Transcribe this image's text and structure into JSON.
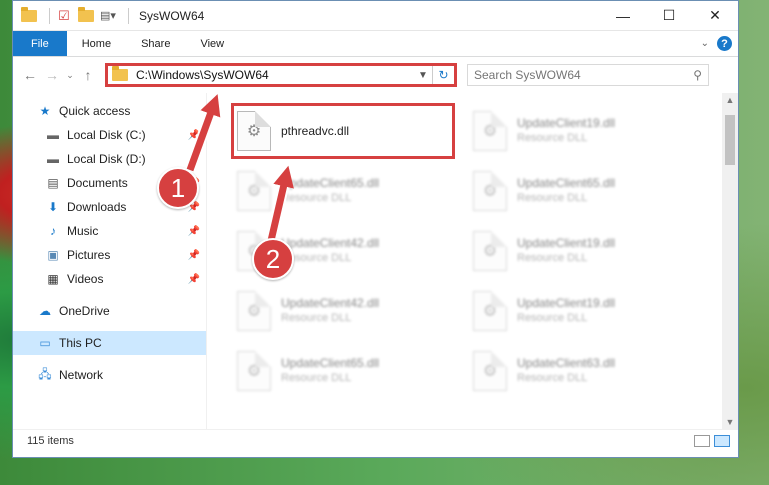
{
  "window": {
    "title": "SysWOW64",
    "controls": {
      "minimize": "—",
      "maximize": "☐",
      "close": "✕"
    }
  },
  "ribbon": {
    "tabs": [
      "File",
      "Home",
      "Share",
      "View"
    ]
  },
  "address": {
    "path": "C:\\Windows\\SysWOW64",
    "search_placeholder": "Search SysWOW64"
  },
  "nav": {
    "quick_access": "Quick access",
    "items": [
      {
        "label": "Local Disk (C:)",
        "icon": "drive-icon"
      },
      {
        "label": "Local Disk (D:)",
        "icon": "drive-icon"
      },
      {
        "label": "Documents",
        "icon": "documents-icon"
      },
      {
        "label": "Downloads",
        "icon": "downloads-icon"
      },
      {
        "label": "Music",
        "icon": "music-icon"
      },
      {
        "label": "Pictures",
        "icon": "pictures-icon"
      },
      {
        "label": "Videos",
        "icon": "videos-icon"
      }
    ],
    "onedrive": "OneDrive",
    "this_pc": "This PC",
    "network": "Network"
  },
  "files": [
    {
      "name": "pthreadvc.dll",
      "type": ""
    },
    {
      "name": "UpdateClient19.dll",
      "type": "Resource DLL"
    },
    {
      "name": "UpdateClient65.dll",
      "type": "Resource DLL"
    },
    {
      "name": "UpdateClient65.dll",
      "type": "Resource DLL"
    },
    {
      "name": "UpdateClient42.dll",
      "type": "Resource DLL"
    },
    {
      "name": "UpdateClient19.dll",
      "type": "Resource DLL"
    },
    {
      "name": "UpdateClient42.dll",
      "type": "Resource DLL"
    },
    {
      "name": "UpdateClient19.dll",
      "type": "Resource DLL"
    },
    {
      "name": "UpdateClient65.dll",
      "type": "Resource DLL"
    },
    {
      "name": "UpdateClient63.dll",
      "type": "Resource DLL"
    }
  ],
  "status": {
    "item_count": "115 items"
  },
  "annotations": {
    "step1": "1",
    "step2": "2"
  },
  "colors": {
    "accent": "#1979ca",
    "highlight": "#d64040"
  }
}
